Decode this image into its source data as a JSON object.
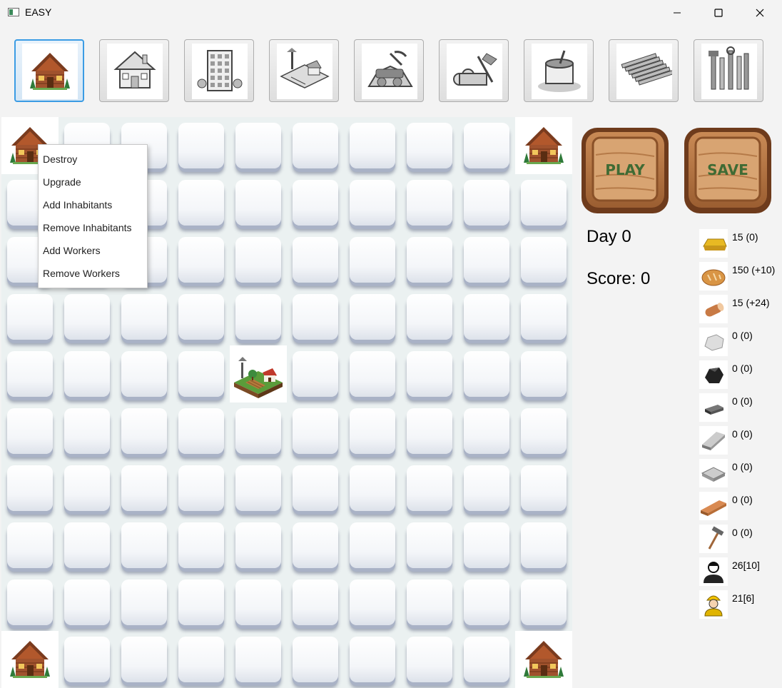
{
  "window": {
    "title": "EASY"
  },
  "toolbar": [
    {
      "name": "log-cabin"
    },
    {
      "name": "house"
    },
    {
      "name": "apartment"
    },
    {
      "name": "farm"
    },
    {
      "name": "quarry"
    },
    {
      "name": "lumber-mill"
    },
    {
      "name": "cement-plant"
    },
    {
      "name": "steel-mill"
    },
    {
      "name": "tool-factory"
    }
  ],
  "grid": {
    "rows": 10,
    "cols": 10,
    "buildings": [
      {
        "row": 0,
        "col": 0,
        "type": "log-cabin"
      },
      {
        "row": 0,
        "col": 9,
        "type": "log-cabin"
      },
      {
        "row": 4,
        "col": 4,
        "type": "farm"
      },
      {
        "row": 9,
        "col": 0,
        "type": "log-cabin"
      },
      {
        "row": 9,
        "col": 9,
        "type": "log-cabin"
      }
    ]
  },
  "context_menu": {
    "items": [
      "Destroy",
      "Upgrade",
      "Add Inhabitants",
      "Remove Inhabitants",
      "Add Workers",
      "Remove Workers"
    ]
  },
  "controls": {
    "play_label": "PLAY",
    "save_label": "SAVE"
  },
  "status": {
    "day_text": "Day 0",
    "score_text": "Score: 0"
  },
  "resources": [
    {
      "icon": "gold-icon",
      "value": "15 (0)"
    },
    {
      "icon": "bread-icon",
      "value": "150 (+10)"
    },
    {
      "icon": "wood-log-icon",
      "value": "15 (+24)"
    },
    {
      "icon": "stone-icon",
      "value": "0 (0)"
    },
    {
      "icon": "coal-icon",
      "value": "0 (0)"
    },
    {
      "icon": "iron-icon",
      "value": "0 (0)"
    },
    {
      "icon": "steel-icon",
      "value": "0 (0)"
    },
    {
      "icon": "cement-icon",
      "value": "0 (0)"
    },
    {
      "icon": "lumber-icon",
      "value": "0 (0)"
    },
    {
      "icon": "tools-icon",
      "value": "0 (0)"
    },
    {
      "icon": "inhabitants-icon",
      "value": "26[10]"
    },
    {
      "icon": "workers-icon",
      "value": "21[6]"
    }
  ],
  "colors": {
    "accent": "#3b9ce4",
    "grid_bg": "#ebf1f1",
    "wood": "#a0663a",
    "label_green": "#3f6b34"
  }
}
